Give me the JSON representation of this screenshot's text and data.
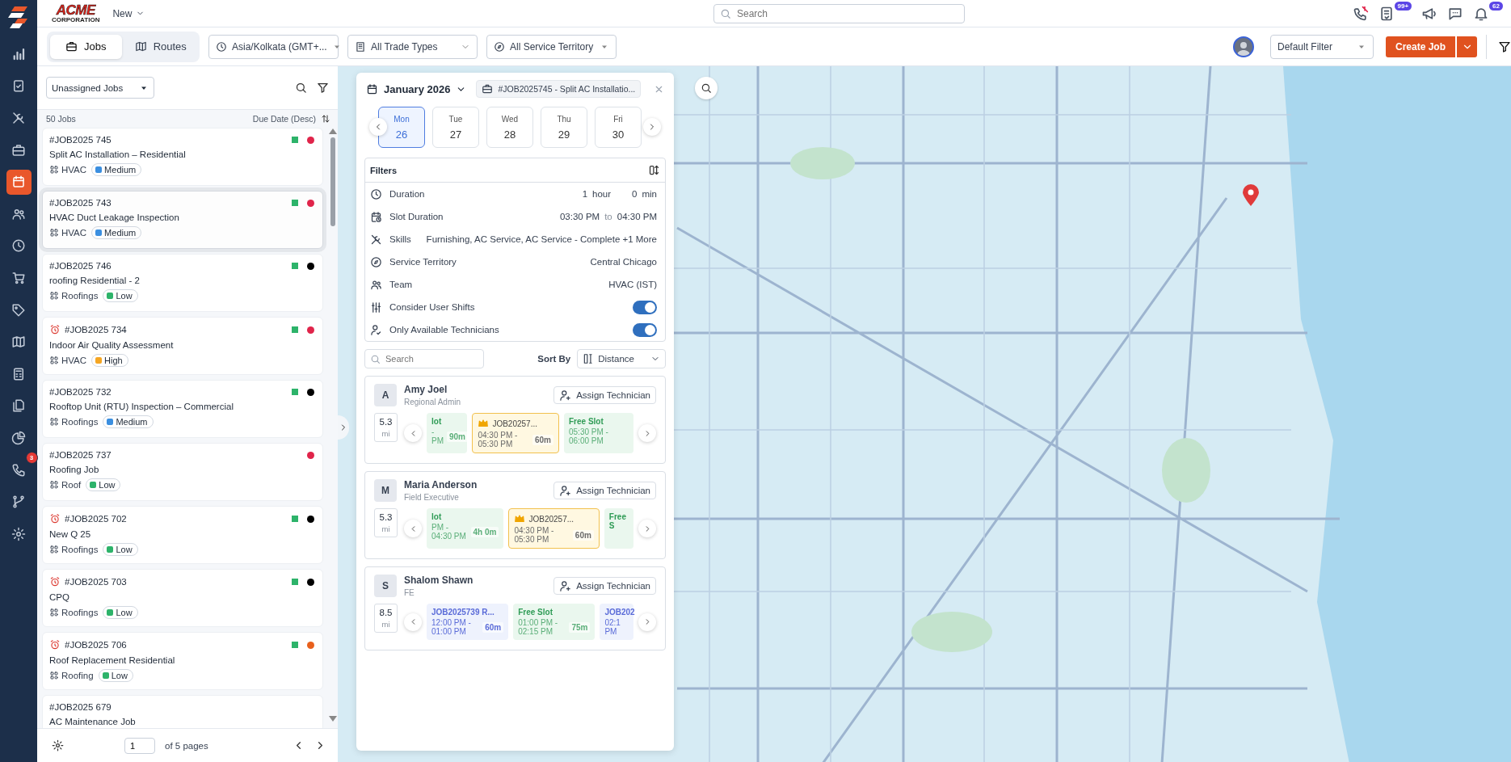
{
  "nav": {
    "items": [
      {
        "kind": "chart",
        "selected": false
      },
      {
        "kind": "clipboard",
        "selected": false
      },
      {
        "kind": "tools",
        "selected": false
      },
      {
        "kind": "briefcase",
        "selected": false
      },
      {
        "kind": "calendar",
        "selected": true
      },
      {
        "kind": "users",
        "selected": false
      },
      {
        "kind": "clock",
        "selected": false
      },
      {
        "kind": "cart",
        "selected": false
      },
      {
        "kind": "tag",
        "selected": false
      },
      {
        "kind": "map",
        "selected": false
      },
      {
        "kind": "calculator",
        "selected": false
      },
      {
        "kind": "documents",
        "selected": false
      },
      {
        "kind": "pie",
        "selected": false
      },
      {
        "kind": "phone",
        "selected": false,
        "badge": "3"
      },
      {
        "kind": "branch",
        "selected": false
      },
      {
        "kind": "settings",
        "selected": false
      }
    ]
  },
  "topbar": {
    "logo": {
      "name": "ACME",
      "subtitle": "CORPORATION"
    },
    "new_menu": "New",
    "search": {
      "placeholder": "Search"
    },
    "icons": [
      {
        "kind": "phone-muted"
      },
      {
        "kind": "tasks",
        "badge": "99+"
      },
      {
        "kind": "megaphone"
      },
      {
        "kind": "chat"
      },
      {
        "kind": "bell",
        "badge": "62"
      }
    ]
  },
  "toolbar": {
    "tabs": [
      {
        "label": "Jobs",
        "kind": "briefcase",
        "selected": true
      },
      {
        "label": "Routes",
        "kind": "map",
        "selected": false
      }
    ],
    "filters": [
      {
        "kind": "clock",
        "value": "Asia/Kolkata (GMT+..."
      },
      {
        "kind": "building",
        "value": "All Trade Types"
      },
      {
        "kind": "compass",
        "value": "All Service Territory"
      }
    ],
    "saved_filter": "Default Filter",
    "create_button": "Create Job"
  },
  "job_list": {
    "view": "Unassigned Jobs",
    "count": "50 Jobs",
    "sort": "Due Date (Desc)",
    "jobs": [
      {
        "id": "#JOB2025 745",
        "overdue": false,
        "selected": false,
        "title": "Split AC Installation – Residential",
        "trade": "HVAC",
        "priority": {
          "label": "Medium",
          "color": "#3b8fe0"
        },
        "status": {
          "color": "#2db36a"
        },
        "dot": {
          "color": "#e0244a"
        }
      },
      {
        "id": "#JOB2025 743",
        "overdue": false,
        "selected": true,
        "title": "HVAC Duct Leakage Inspection",
        "trade": "HVAC",
        "priority": {
          "label": "Medium",
          "color": "#3b8fe0"
        },
        "status": {
          "color": "#2db36a"
        },
        "dot": {
          "color": "#e0244a"
        }
      },
      {
        "id": "#JOB2025 746",
        "overdue": false,
        "selected": false,
        "title": "roofing Residential - 2",
        "trade": "Roofings",
        "priority": {
          "label": "Low",
          "color": "#2db36a"
        },
        "status": {
          "color": "#2db36a"
        },
        "dot": {
          "color": "#000000"
        }
      },
      {
        "id": "#JOB2025 734",
        "overdue": true,
        "selected": false,
        "title": "Indoor Air Quality Assessment",
        "trade": "HVAC",
        "priority": {
          "label": "High",
          "color": "#f5a623"
        },
        "status": {
          "color": "#2db36a"
        },
        "dot": {
          "color": "#e0244a"
        }
      },
      {
        "id": "#JOB2025 732",
        "overdue": false,
        "selected": false,
        "title": "Rooftop Unit (RTU) Inspection – Commercial",
        "trade": "Roofings",
        "priority": {
          "label": "Medium",
          "color": "#3b8fe0"
        },
        "status": {
          "color": "#2db36a"
        },
        "dot": {
          "color": "#000000"
        }
      },
      {
        "id": "#JOB2025 737",
        "overdue": false,
        "selected": false,
        "title": "Roofing Job",
        "trade": "Roof",
        "priority": {
          "label": "Low",
          "color": "#2db36a"
        },
        "dot": {
          "color": "#e0244a"
        }
      },
      {
        "id": "#JOB2025 702",
        "overdue": true,
        "selected": false,
        "title": "New Q 25",
        "trade": "Roofings",
        "priority": {
          "label": "Low",
          "color": "#2db36a"
        },
        "status": {
          "color": "#2db36a"
        },
        "dot": {
          "color": "#000000"
        }
      },
      {
        "id": "#JOB2025 703",
        "overdue": true,
        "selected": false,
        "title": "CPQ",
        "trade": "Roofings",
        "priority": {
          "label": "Low",
          "color": "#2db36a"
        },
        "status": {
          "color": "#2db36a"
        },
        "dot": {
          "color": "#000000"
        }
      },
      {
        "id": "#JOB2025 706",
        "overdue": true,
        "selected": false,
        "title": "Roof Replacement Residential",
        "trade": "Roofing",
        "priority": {
          "label": "Low",
          "color": "#2db36a"
        },
        "status": {
          "color": "#2db36a"
        },
        "dot": {
          "color": "#e8601c"
        }
      },
      {
        "id": "#JOB2025 679",
        "overdue": false,
        "selected": false,
        "title": "AC Maintenance Job"
      }
    ],
    "page": "1",
    "pages": "of 5 pages"
  },
  "scheduler": {
    "month": "January 2026",
    "job_chip": "#JOB2025745 - Split AC Installatio...",
    "days": [
      {
        "weekday": "Mon",
        "day": "26",
        "selected": true
      },
      {
        "weekday": "Tue",
        "day": "27",
        "selected": false
      },
      {
        "weekday": "Wed",
        "day": "28",
        "selected": false
      },
      {
        "weekday": "Thu",
        "day": "29",
        "selected": false
      },
      {
        "weekday": "Fri",
        "day": "30",
        "selected": false
      }
    ],
    "filters_title": "Filters",
    "filters": [
      {
        "kind": "duration",
        "label": "Duration",
        "hours": "1",
        "hour_unit": "hour",
        "minutes": "0",
        "minute_unit": "min"
      },
      {
        "kind": "range",
        "label": "Slot Duration",
        "from": "03:30 PM",
        "separator": "to",
        "to": "04:30 PM"
      },
      {
        "kind": "value",
        "label": "Skills",
        "value": "Furnishing, AC Service, AC Service - Complete +1 More"
      },
      {
        "kind": "value",
        "label": "Service Territory",
        "value": "Central Chicago"
      },
      {
        "kind": "value",
        "label": "Team",
        "value": "HVAC (IST)"
      },
      {
        "kind": "toggle",
        "label": "Consider User Shifts",
        "on": true
      },
      {
        "kind": "toggle",
        "label": "Only Available Technicians",
        "on": true
      }
    ],
    "search": {
      "placeholder": "Search"
    },
    "sort_label": "Sort By",
    "sort_value": "Distance",
    "technicians": [
      {
        "initial": "A",
        "name": "Amy Joel",
        "role": "Regional Admin",
        "action": "Assign Technician",
        "distance": "5.3",
        "unit": "mi",
        "slots": [
          {
            "kind": "free",
            "title": "lot",
            "time": "- PM",
            "duration": "90m"
          },
          {
            "kind": "job",
            "title": "JOB20257...",
            "time": "04:30 PM - 05:30 PM",
            "duration": "60m"
          },
          {
            "kind": "free",
            "title": "Free Slot",
            "time": "05:30 PM - 06:00 PM"
          }
        ]
      },
      {
        "initial": "M",
        "name": "Maria Anderson",
        "role": "Field Executive",
        "action": "Assign Technician",
        "distance": "5.3",
        "unit": "mi",
        "slots": [
          {
            "kind": "free",
            "title": "lot",
            "time": "PM - 04:30 PM",
            "duration": "4h 0m"
          },
          {
            "kind": "job",
            "title": "JOB20257...",
            "time": "04:30 PM - 05:30 PM",
            "duration": "60m"
          },
          {
            "kind": "free",
            "title": "Free S"
          }
        ]
      },
      {
        "initial": "S",
        "name": "Shalom Shawn",
        "role": "FE",
        "action": "Assign Technician",
        "distance": "8.5",
        "unit": "mi",
        "slots": [
          {
            "kind": "booked",
            "title": "JOB2025739 R...",
            "time": "12:00 PM - 01:00 PM",
            "duration": "60m"
          },
          {
            "kind": "free",
            "title": "Free Slot",
            "time": "01:00 PM - 02:15 PM",
            "duration": "75m"
          },
          {
            "kind": "booked",
            "title": "JOB202",
            "time": "02:1 PM"
          }
        ]
      }
    ]
  }
}
